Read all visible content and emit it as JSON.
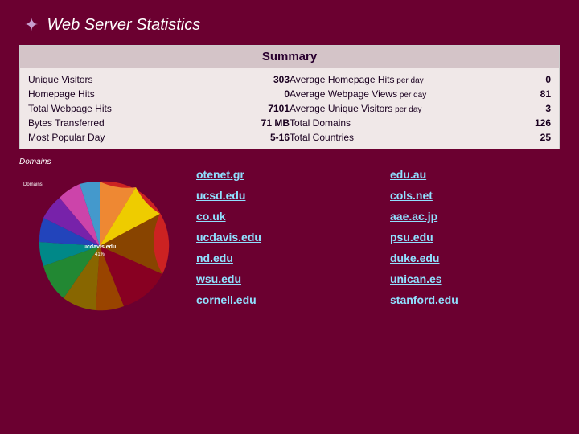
{
  "header": {
    "icon": "✦",
    "title": "Web Server Statistics"
  },
  "summary": {
    "heading": "Summary",
    "left_rows": [
      {
        "label": "Unique Visitors",
        "value": "303"
      },
      {
        "label": "Homepage Hits",
        "value": "0"
      },
      {
        "label": "Total Webpage Hits",
        "value": "7101"
      },
      {
        "label": "Bytes Transferred",
        "value": "71 MB"
      },
      {
        "label": "Most Popular Day",
        "value": "5-16"
      }
    ],
    "right_rows": [
      {
        "label": "Average Homepage Hits",
        "sublabel": "per day",
        "value": "0"
      },
      {
        "label": "Average Webpage Views",
        "sublabel": "per day",
        "value": "81"
      },
      {
        "label": "Average Unique Visitors",
        "sublabel": "per day",
        "value": "3"
      },
      {
        "label": "Total Domains",
        "sublabel": "",
        "value": "126"
      },
      {
        "label": "Total Countries",
        "sublabel": "",
        "value": "25"
      }
    ]
  },
  "chart": {
    "title": "Domains"
  },
  "domains": [
    "otenet.gr",
    "edu.au",
    "ucsd.edu",
    "cols.net",
    "co.uk",
    "aae.ac.jp",
    "ucdavis.edu",
    "psu.edu",
    "nd.edu",
    "duke.edu",
    "wsu.edu",
    "unican.es",
    "cornell.edu",
    "stanford.edu"
  ]
}
